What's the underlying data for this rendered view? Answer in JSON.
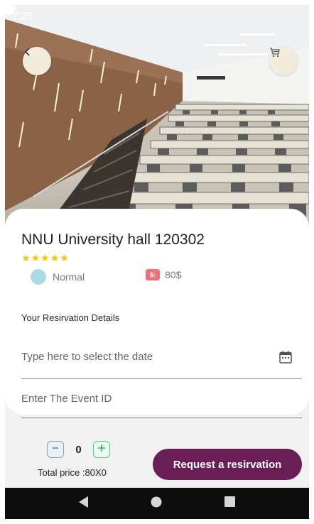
{
  "status_bar": {
    "time": "7:25",
    "icons": [
      "gear-icon",
      "sim-card-icon",
      "wifi-icon",
      "signal-icon",
      "battery-icon"
    ]
  },
  "header": {
    "back_icon": "chevron-left-icon",
    "cart_icon": "cart-icon",
    "hero_image": "lecture-hall-photo"
  },
  "venue": {
    "name": "NNU University hall 120302",
    "rating_stars": 5,
    "type_label": "Normal",
    "price_badge": "$:",
    "price": "80$"
  },
  "reservation": {
    "section_title": "Your Resirvation Details",
    "date_placeholder": "Type here to select the date",
    "event_placeholder": "Enter The Event ID"
  },
  "order": {
    "quantity": "0",
    "total_label": "Total price :80X0",
    "button_label": "Request a resirvation"
  },
  "colors": {
    "accent": "#6b1d55",
    "star": "#f5c800",
    "type_dot": "#a9dbe8",
    "price_badge": "#f16f7b",
    "plus": "#4bd07e",
    "minus": "#8aa1b3"
  }
}
